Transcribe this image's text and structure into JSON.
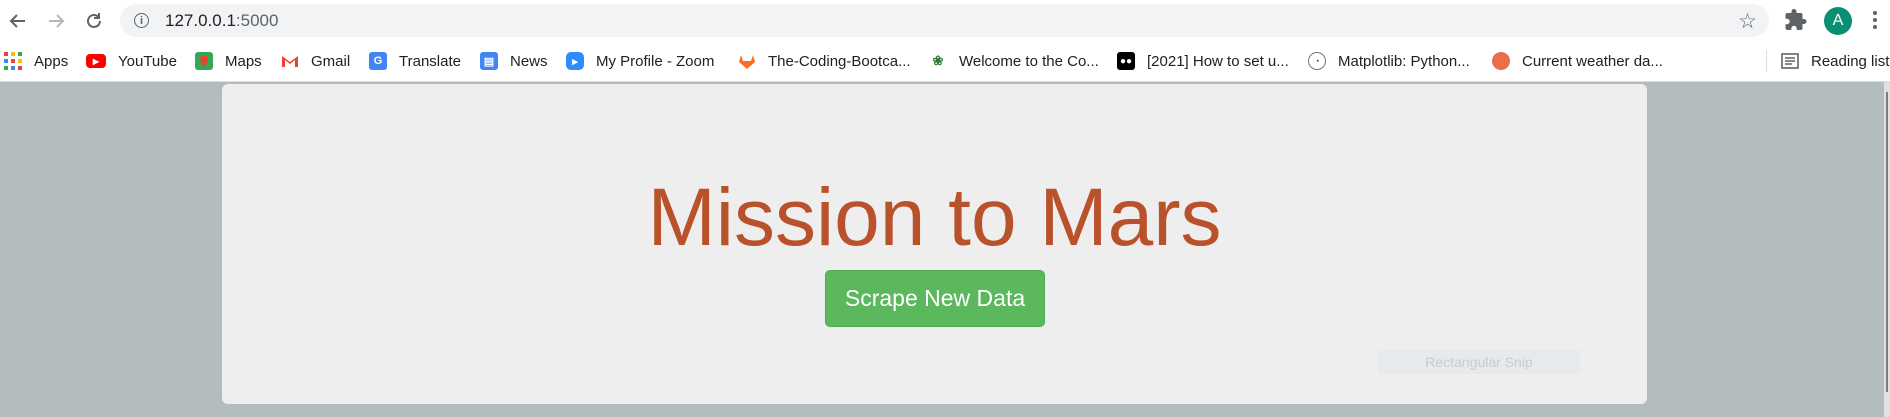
{
  "browser": {
    "url_host": "127.0.0.1",
    "url_port": ":5000",
    "profile_initial": "A",
    "bookmarks": [
      {
        "label": "Apps",
        "icon": "apps-grid-icon"
      },
      {
        "label": "YouTube",
        "icon": "youtube-icon"
      },
      {
        "label": "Maps",
        "icon": "maps-icon"
      },
      {
        "label": "Gmail",
        "icon": "gmail-icon"
      },
      {
        "label": "Translate",
        "icon": "translate-icon"
      },
      {
        "label": "News",
        "icon": "news-icon"
      },
      {
        "label": "My Profile - Zoom",
        "icon": "zoom-icon"
      },
      {
        "label": "The-Coding-Bootca...",
        "icon": "gitlab-icon"
      },
      {
        "label": "Welcome to the Co...",
        "icon": "lotus-icon"
      },
      {
        "label": "[2021] How to set u...",
        "icon": "medium-icon"
      },
      {
        "label": "Matplotlib: Python...",
        "icon": "matplotlib-icon"
      },
      {
        "label": "Current weather da...",
        "icon": "weather-icon"
      }
    ],
    "reading_list_label": "Reading list"
  },
  "page": {
    "title": "Mission to Mars",
    "scrape_button_label": "Scrape New Data",
    "snip_overlay_text": "Rectangular Snip"
  },
  "colors": {
    "title": "#b9512b",
    "button": "#5cb85c",
    "page_background": "#b3bdbf",
    "jumbotron": "#eeeeee"
  }
}
